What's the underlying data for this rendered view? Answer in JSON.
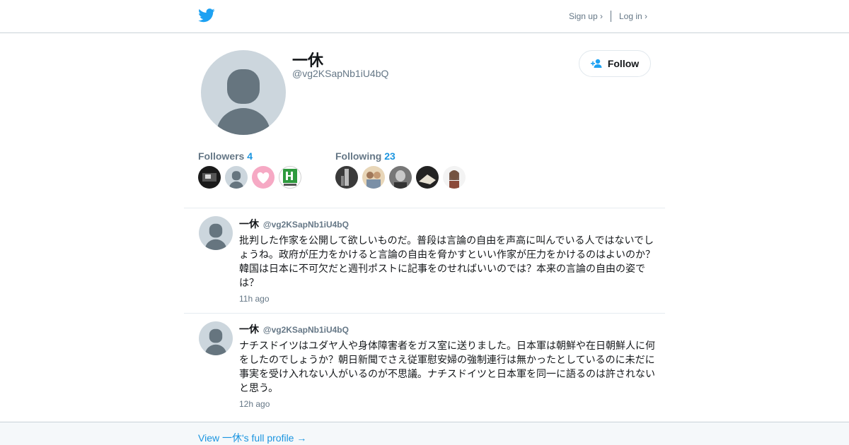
{
  "header": {
    "signup_label": "Sign up ›",
    "login_label": "Log in ›",
    "brand_color": "#1da1f2",
    "logo_icon": "twitter-bird-icon"
  },
  "profile": {
    "name": "一休",
    "handle": "@vg2KSapNb1iU4bQ",
    "follow_label": "Follow",
    "followers_label": "Followers",
    "followers_count": "4",
    "following_label": "Following",
    "following_count": "23"
  },
  "tweets": [
    {
      "name": "一休",
      "handle": "@vg2KSapNb1iU4bQ",
      "lines": [
        "批判した作家を公開して欲しいものだ。普段は言論の自由を声高に叫んでいる人ではないでし",
        "ょうね。政府が圧力をかけると言論の自由を脅かすといい作家が圧力をかけるのはよいのか？",
        "韓国は日本に不可欠だと週刊ポストに記事をのせればいいのでは？本来の言論の自由の姿で",
        "は？"
      ],
      "time": "11h ago"
    },
    {
      "name": "一休",
      "handle": "@vg2KSapNb1iU4bQ",
      "lines": [
        "ナチスドイツはユダヤ人や身体障害者をガス室に送りました。日本軍は朝鮮や在日朝鮮人に何",
        "をしたのでしょうか？朝日新聞でさえ従軍慰安婦の強制連行は無かったとしているのに未だに",
        "事実を受け入れない人がいるのが不思議。ナチスドイツと日本軍を同一に語るのは許されない",
        "と思う。"
      ],
      "time": "12h ago"
    }
  ],
  "footer": {
    "link_label": "View 一休's full profile →"
  },
  "colors": {
    "link": "#1b95e0",
    "muted": "#657786",
    "avatar_bg": "#ccd6dd",
    "avatar_fg": "#66757f"
  }
}
